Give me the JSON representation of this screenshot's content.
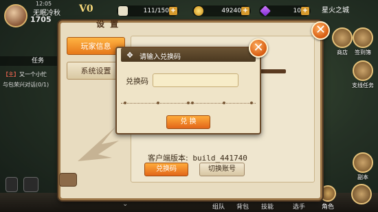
{
  "hud": {
    "time": "12:05",
    "player_name": "无眠冷秋",
    "player_number": "1705",
    "vip": "V0",
    "stamina": "111/150",
    "gold": "49240",
    "gems": "10",
    "server": "星火之城"
  },
  "quest": {
    "header": "任务",
    "main_tag": "【主】",
    "main_title": "又一个小忙",
    "main_desc": "与包荣兴对话(0/1)"
  },
  "right_menu": [
    {
      "label": "商店"
    },
    {
      "label": "签到簿"
    },
    {
      "label": "支线任务"
    }
  ],
  "bottom_menu": [
    {
      "label": "组队"
    },
    {
      "label": "背包"
    },
    {
      "label": "技能"
    },
    {
      "label": "选手"
    },
    {
      "label": "角色"
    }
  ],
  "dungeon_label": "副本",
  "settings": {
    "title": "设 置",
    "tabs": [
      "玩家信息",
      "系统设置"
    ],
    "client_version_label": "客户端版本:",
    "client_version": "build_441740",
    "redeem_button": "兑换码",
    "switch_account_button": "切换账号"
  },
  "redeem_dialog": {
    "title": "请输入兑换码",
    "field_label": "兑换码",
    "input_value": "",
    "input_placeholder": "",
    "submit": "兑 换"
  },
  "colors": {
    "accent_orange": "#e6781a",
    "panel_bg": "#e8dcc0",
    "frame_brown": "#9a7446"
  }
}
